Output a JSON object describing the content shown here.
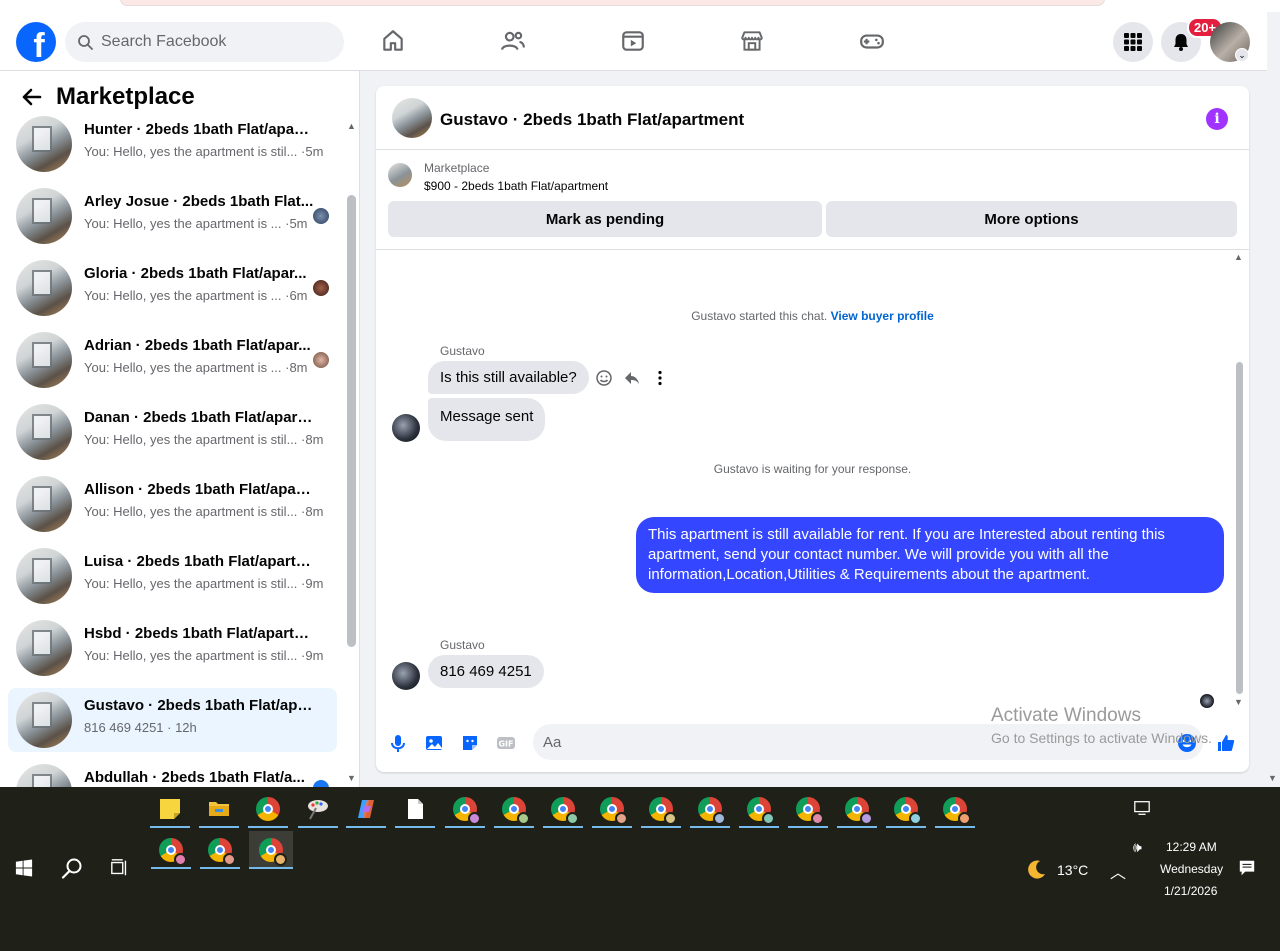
{
  "topnav": {
    "logo": "f",
    "search_placeholder": "Search Facebook",
    "notification_badge": "20+"
  },
  "sidebar": {
    "title": "Marketplace",
    "conversations": [
      {
        "name": "Hunter · 2beds 1bath Flat/apart...",
        "preview": "You: Hello, yes the apartment is stil... ·5m"
      },
      {
        "name": "Arley Josue · 2beds 1bath Flat...",
        "preview": "You: Hello, yes the apartment is ... ·5m"
      },
      {
        "name": "Gloria · 2beds 1bath Flat/apar...",
        "preview": "You: Hello, yes the apartment is ... ·6m"
      },
      {
        "name": "Adrian · 2beds 1bath Flat/apar...",
        "preview": "You: Hello, yes the apartment is ... ·8m"
      },
      {
        "name": "Danan · 2beds 1bath Flat/apart...",
        "preview": "You: Hello, yes the apartment is stil... ·8m"
      },
      {
        "name": "Allison · 2beds 1bath Flat/apart...",
        "preview": "You: Hello, yes the apartment is stil... ·8m"
      },
      {
        "name": "Luisa · 2beds 1bath Flat/apartme...",
        "preview": "You: Hello, yes the apartment is stil... ·9m"
      },
      {
        "name": "Hsbd · 2beds 1bath Flat/apartm...",
        "preview": "You: Hello, yes the apartment is stil... ·9m"
      },
      {
        "name": "Gustavo · 2beds 1bath Flat/apart...",
        "preview": "816 469 4251 · 12h"
      },
      {
        "name": "Abdullah · 2beds 1bath Flat/a...",
        "preview": ""
      }
    ]
  },
  "chat": {
    "title": "Gustavo · 2beds 1bath Flat/apartment",
    "listing_source": "Marketplace",
    "listing_price": "$900 - 2beds 1bath Flat/apartment",
    "mark_pending": "Mark as pending",
    "more_options": "More options",
    "started": "Gustavo started this chat.",
    "view_profile": "View buyer profile",
    "sender1": "Gustavo",
    "msg1": "Is this still available?",
    "msg2": "Message sent",
    "waiting": "Gustavo is waiting for your response.",
    "outgoing": "This apartment is still available for rent. If you are Interested about renting this apartment, send your contact number. We will provide you with all the information,Location,Utilities & Requirements about the apartment.",
    "sender2": "Gustavo",
    "msg3": "816 469 4251",
    "input_placeholder": "Aa"
  },
  "watermark": {
    "line1": "Activate Windows",
    "line2": "Go to Settings to activate Windows."
  },
  "taskbar": {
    "weather_temp": "13°C",
    "time": "12:29 AM",
    "day": "Wednesday",
    "date": "1/21/2026"
  }
}
